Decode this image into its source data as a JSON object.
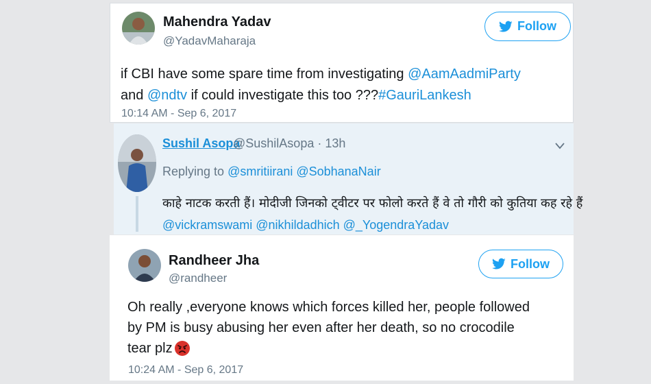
{
  "tweet1": {
    "name": "Mahendra Yadav",
    "handle": "@YadavMaharaja",
    "follow_label": "Follow",
    "text_1": "if CBI have some spare time from investigating ",
    "mention_1": "@AamAadmiParty",
    "text_2": "and ",
    "mention_2": "@ndtv",
    "text_3": " if could investigate this too ???",
    "hashtag": "#GauriLankesh",
    "timestamp": "10:14 AM - Sep 6, 2017"
  },
  "quoted": {
    "name": "Sushil Asopa",
    "meta": "@SushilAsopa · 13h",
    "replying_prefix": "Replying to ",
    "replying_mentions": "@smritiirani @SobhanaNair",
    "text": "काहे नाटक करती हैं। मोदीजी जिनको ट्वीटर पर फोलो करते हैं वे तो गौरी को कुतिया कह रहे हैं",
    "mentions_line": "@vickramswami @nikhildadhich @_YogendraYadav"
  },
  "tweet2": {
    "name": "Randheer Jha",
    "handle": "@randheer",
    "follow_label": "Follow",
    "line_1": "Oh really ,everyone knows which forces killed her, people followed",
    "line_2": "by PM is busy abusing her even after her death, so no crocodile",
    "line_3": "tear plz",
    "emoji": "😡",
    "timestamp": "10:24 AM - Sep 6, 2017"
  },
  "colors": {
    "accent": "#1da1f2",
    "link": "#1b8fd8",
    "angry_emoji": "#d9322b"
  },
  "icons": [
    "twitter-bird-icon",
    "chevron-down-icon",
    "angry-face-icon"
  ]
}
